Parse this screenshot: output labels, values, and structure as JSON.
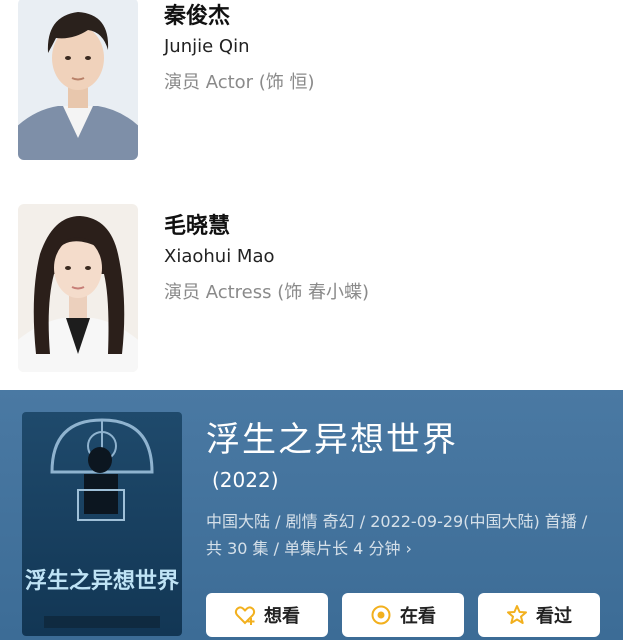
{
  "cast": [
    {
      "name_cn": "秦俊杰",
      "name_en": "Junjie Qin",
      "role": "演员 Actor (饰 恒)"
    },
    {
      "name_cn": "毛晓慧",
      "name_en": "Xiaohui Mao",
      "role": "演员 Actress (饰 春小蝶)"
    }
  ],
  "movie": {
    "title": "浮生之异想世界",
    "year": "(2022)",
    "meta": "中国大陆 / 剧情 奇幻 / 2022-09-29(中国大陆) 首播 / 共 30 集 / 单集片长 4 分钟 ›",
    "poster_text": "浮生之异想世界"
  },
  "actions": {
    "want_label": "想看",
    "watching_label": "在看",
    "watched_label": "看过"
  },
  "colors": {
    "movie_bg": "#4a79a3",
    "action_icon": "#f2b01e"
  }
}
